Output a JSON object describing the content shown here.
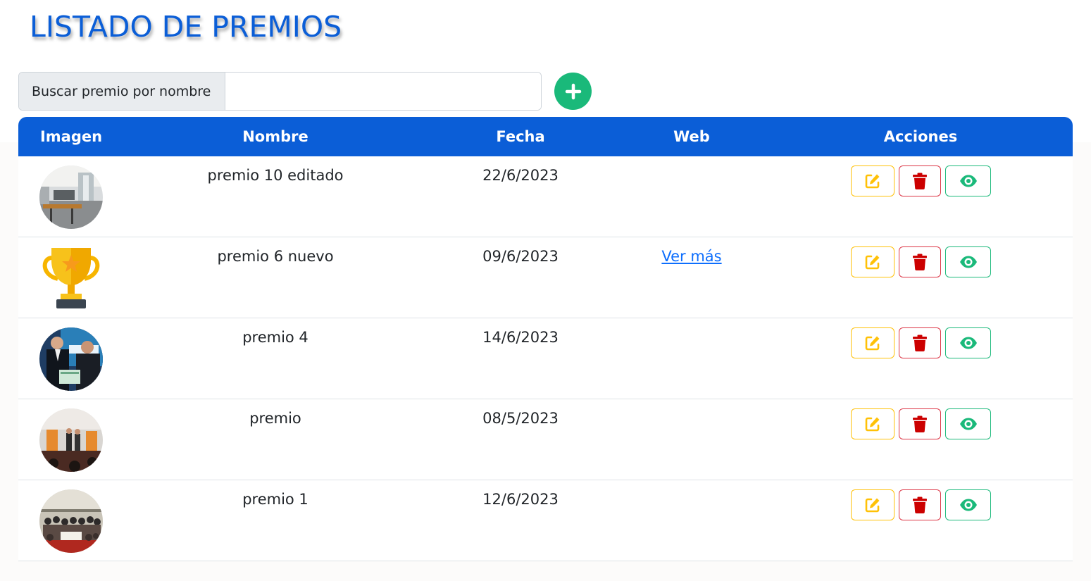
{
  "title": "LISTADO DE PREMIOS",
  "search": {
    "label": "Buscar premio por nombre",
    "value": "",
    "placeholder": ""
  },
  "colors": {
    "primary": "#0b5ed7",
    "add_button": "#1ab97a",
    "edit": "#ffc107",
    "delete": "#dc3545",
    "view": "#1ab97a"
  },
  "table": {
    "headers": {
      "image": "Imagen",
      "name": "Nombre",
      "date": "Fecha",
      "web": "Web",
      "actions": "Acciones"
    },
    "rows": [
      {
        "image": "kitchen-photo",
        "name": "premio 10 editado",
        "date": "22/6/2023",
        "web": ""
      },
      {
        "image": "trophy-icon",
        "name": "premio 6 nuevo",
        "date": "09/6/2023",
        "web": "Ver más"
      },
      {
        "image": "award-ceremony-photo",
        "name": "premio 4",
        "date": "14/6/2023",
        "web": ""
      },
      {
        "image": "stage-event-photo",
        "name": "premio",
        "date": "08/5/2023",
        "web": ""
      },
      {
        "image": "group-photo",
        "name": "premio 1",
        "date": "12/6/2023",
        "web": ""
      }
    ]
  },
  "icons": {
    "add": "plus-icon",
    "edit": "pencil-square-icon",
    "delete": "trash-icon",
    "view": "eye-icon"
  }
}
